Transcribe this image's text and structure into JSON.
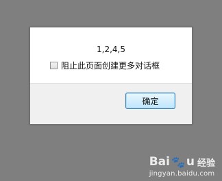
{
  "dialog": {
    "message": "1,2,4,5",
    "checkbox_label": "阻止此页面创建更多对话框",
    "checkbox_checked": false,
    "ok_label": "确定"
  },
  "watermark": {
    "brand_left": "Bai",
    "brand_right": "u",
    "brand_sub": "经验",
    "url": "jingyan.baidu.com"
  }
}
